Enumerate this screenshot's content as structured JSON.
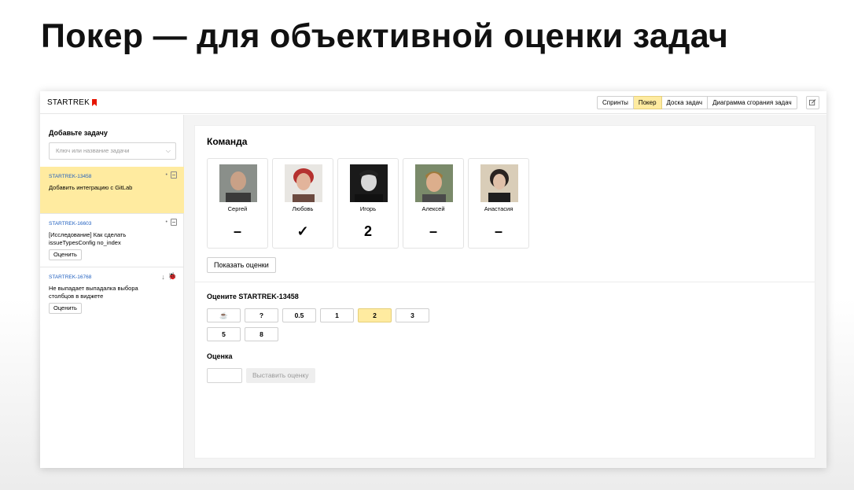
{
  "slide": {
    "title": "Покер — для объективной оценки задач"
  },
  "app": {
    "logo": "STARTREK",
    "nav": [
      {
        "label": "Спринты",
        "active": false
      },
      {
        "label": "Покер",
        "active": true
      },
      {
        "label": "Доска задач",
        "active": false
      },
      {
        "label": "Диаграмма сгорания задач",
        "active": false
      }
    ]
  },
  "sidebar": {
    "title": "Добавьте задачу",
    "search_placeholder": "Ключ или название задачи",
    "tasks": [
      {
        "key": "STARTREK-13458",
        "text": "Добавить интеграцию с GitLab",
        "selected": true
      },
      {
        "key": "STARTREK-16603",
        "text": "[Исследование] Как сделать issueTypesConfig no_index",
        "button": "Оценить"
      },
      {
        "key": "STARTREK-16768",
        "text": "Не выпадает выпадалка выбора столбцов в виджете",
        "button": "Оценить"
      }
    ]
  },
  "team": {
    "title": "Команда",
    "members": [
      {
        "name": "Сергей",
        "vote": "–"
      },
      {
        "name": "Любовь",
        "vote": "✓"
      },
      {
        "name": "Игорь",
        "vote": "2"
      },
      {
        "name": "Алексей",
        "vote": "–"
      },
      {
        "name": "Анастасия",
        "vote": "–"
      }
    ],
    "show_button": "Показать оценки"
  },
  "rating": {
    "title": "Оцените STARTREK-13458",
    "options": [
      "☕",
      "?",
      "0.5",
      "1",
      "2",
      "3",
      "5",
      "8"
    ],
    "selected": "2"
  },
  "score": {
    "title": "Оценка",
    "submit_label": "Выставить оценку"
  },
  "colors": {
    "accent": "#ffeba0",
    "logo_red": "#e61400",
    "link": "#1f5fbf"
  }
}
